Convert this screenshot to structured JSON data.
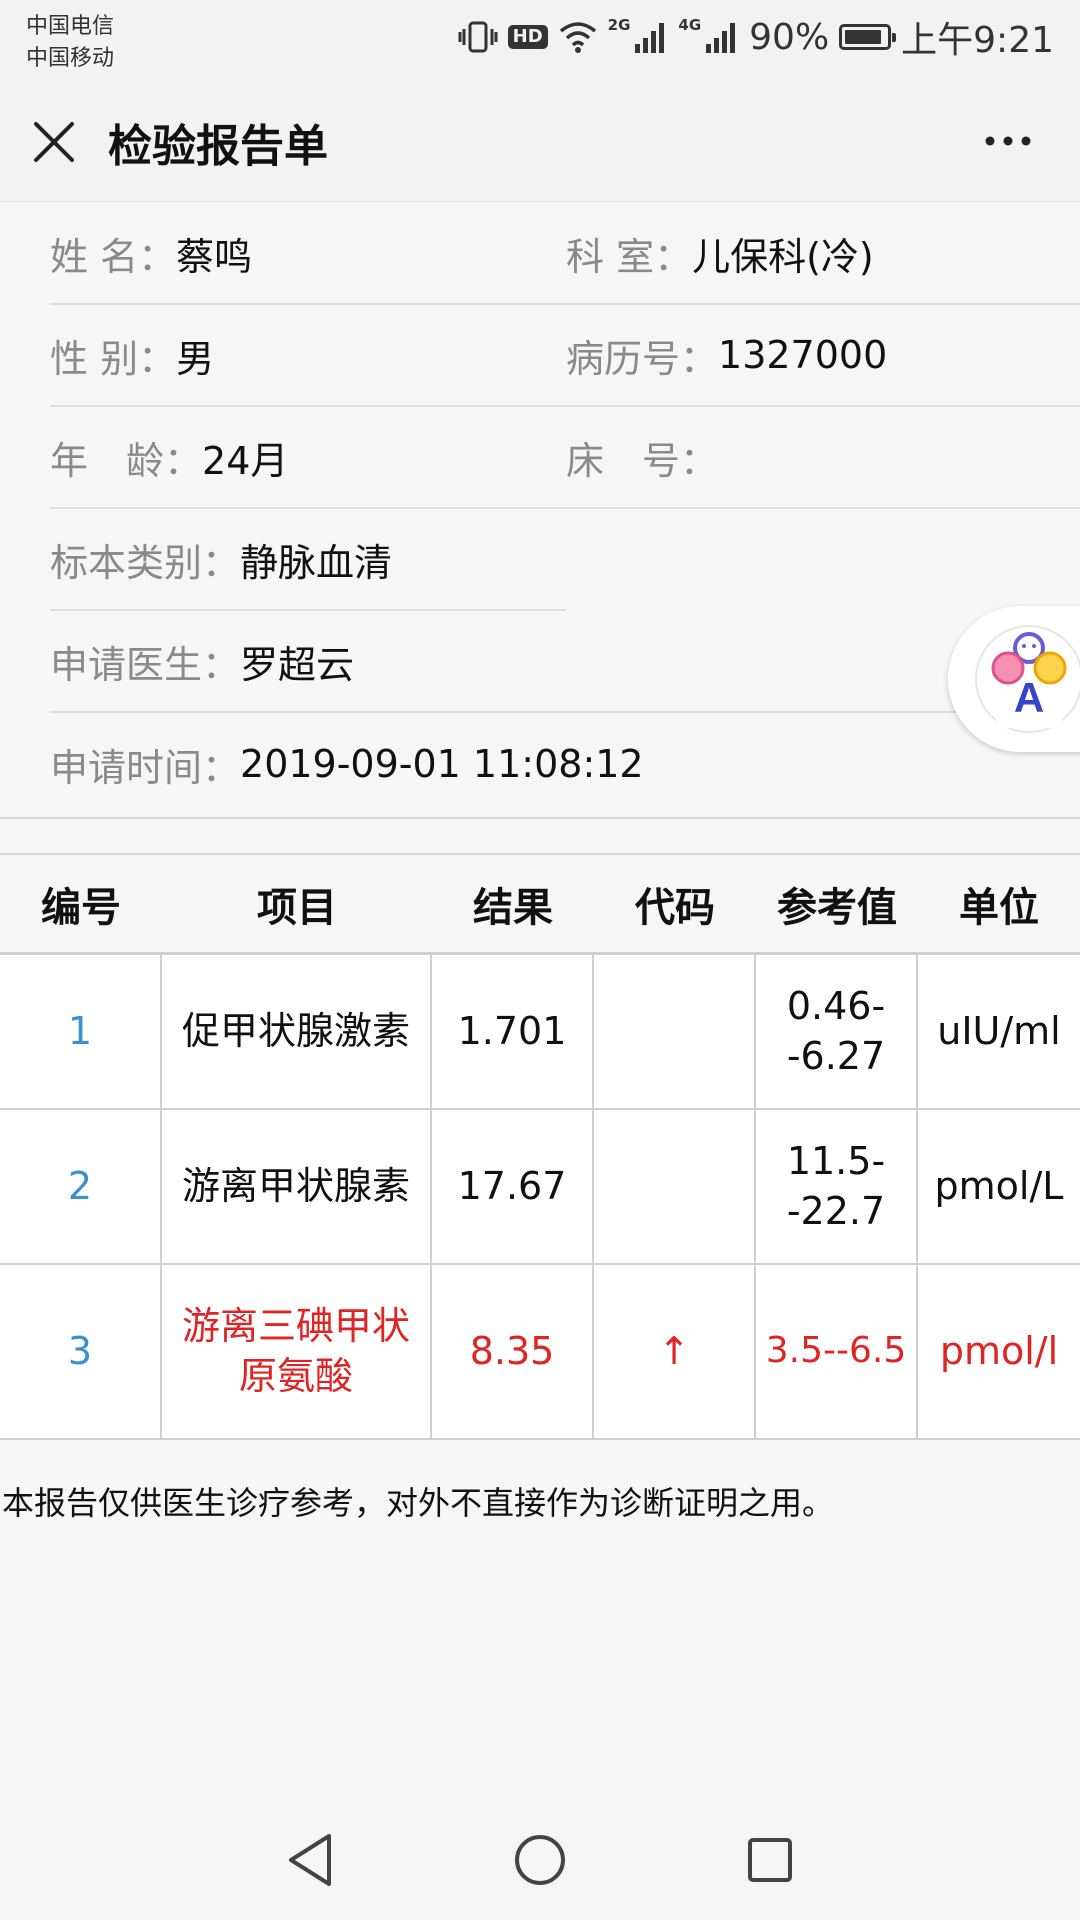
{
  "status_bar": {
    "carrier_1": "中国电信",
    "carrier_2": "中国移动",
    "net_1": "2G",
    "net_2": "4G",
    "battery_text": "90%",
    "battery_level": 0.9,
    "time": "上午9:21",
    "icons": [
      "vibrate-icon",
      "hd-icon",
      "wifi-icon",
      "signal-icon",
      "signal-icon",
      "battery-icon"
    ]
  },
  "header": {
    "title": "检验报告单",
    "close_icon": "close-icon",
    "more_icon": "more-icon"
  },
  "patient": {
    "name_label": "姓 名：",
    "name": "蔡鸣",
    "dept_label": "科 室：",
    "dept": "儿保科(冷)",
    "gender_label": "性 别：",
    "gender": "男",
    "record_label": "病历号：",
    "record": "1327000",
    "age_label": "年　龄：",
    "age": "24月",
    "bed_label": "床　号：",
    "bed": "",
    "specimen_label": "标本类别：",
    "specimen": "静脉血清",
    "doctor_label": "申请医生：",
    "doctor": "罗超云",
    "time_label": "申请时间：",
    "time": "2019-09-01 11:08:12"
  },
  "table": {
    "headers": [
      "编号",
      "项目",
      "结果",
      "代码",
      "参考值",
      "单位"
    ],
    "rows": [
      {
        "no": "1",
        "item": "促甲状腺激素",
        "result": "1.701",
        "code": "",
        "ref": "0.46--6.27",
        "unit": "uIU/ml",
        "abnormal": false
      },
      {
        "no": "2",
        "item": "游离甲状腺素",
        "result": "17.67",
        "code": "",
        "ref": "11.5--22.7",
        "unit": "pmol/L",
        "abnormal": false
      },
      {
        "no": "3",
        "item": "游离三碘甲状原氨酸",
        "result": "8.35",
        "code": "↑",
        "ref": "3.5--6.5",
        "unit": "pmol/l",
        "abnormal": true
      }
    ]
  },
  "note": "本报告仅供医生诊疗参考，对外不直接作为诊断证明之用。",
  "colors": {
    "abnormal": "#e02424",
    "number": "#3a8fd0"
  },
  "nav": [
    "back-icon",
    "home-icon",
    "recents-icon"
  ]
}
